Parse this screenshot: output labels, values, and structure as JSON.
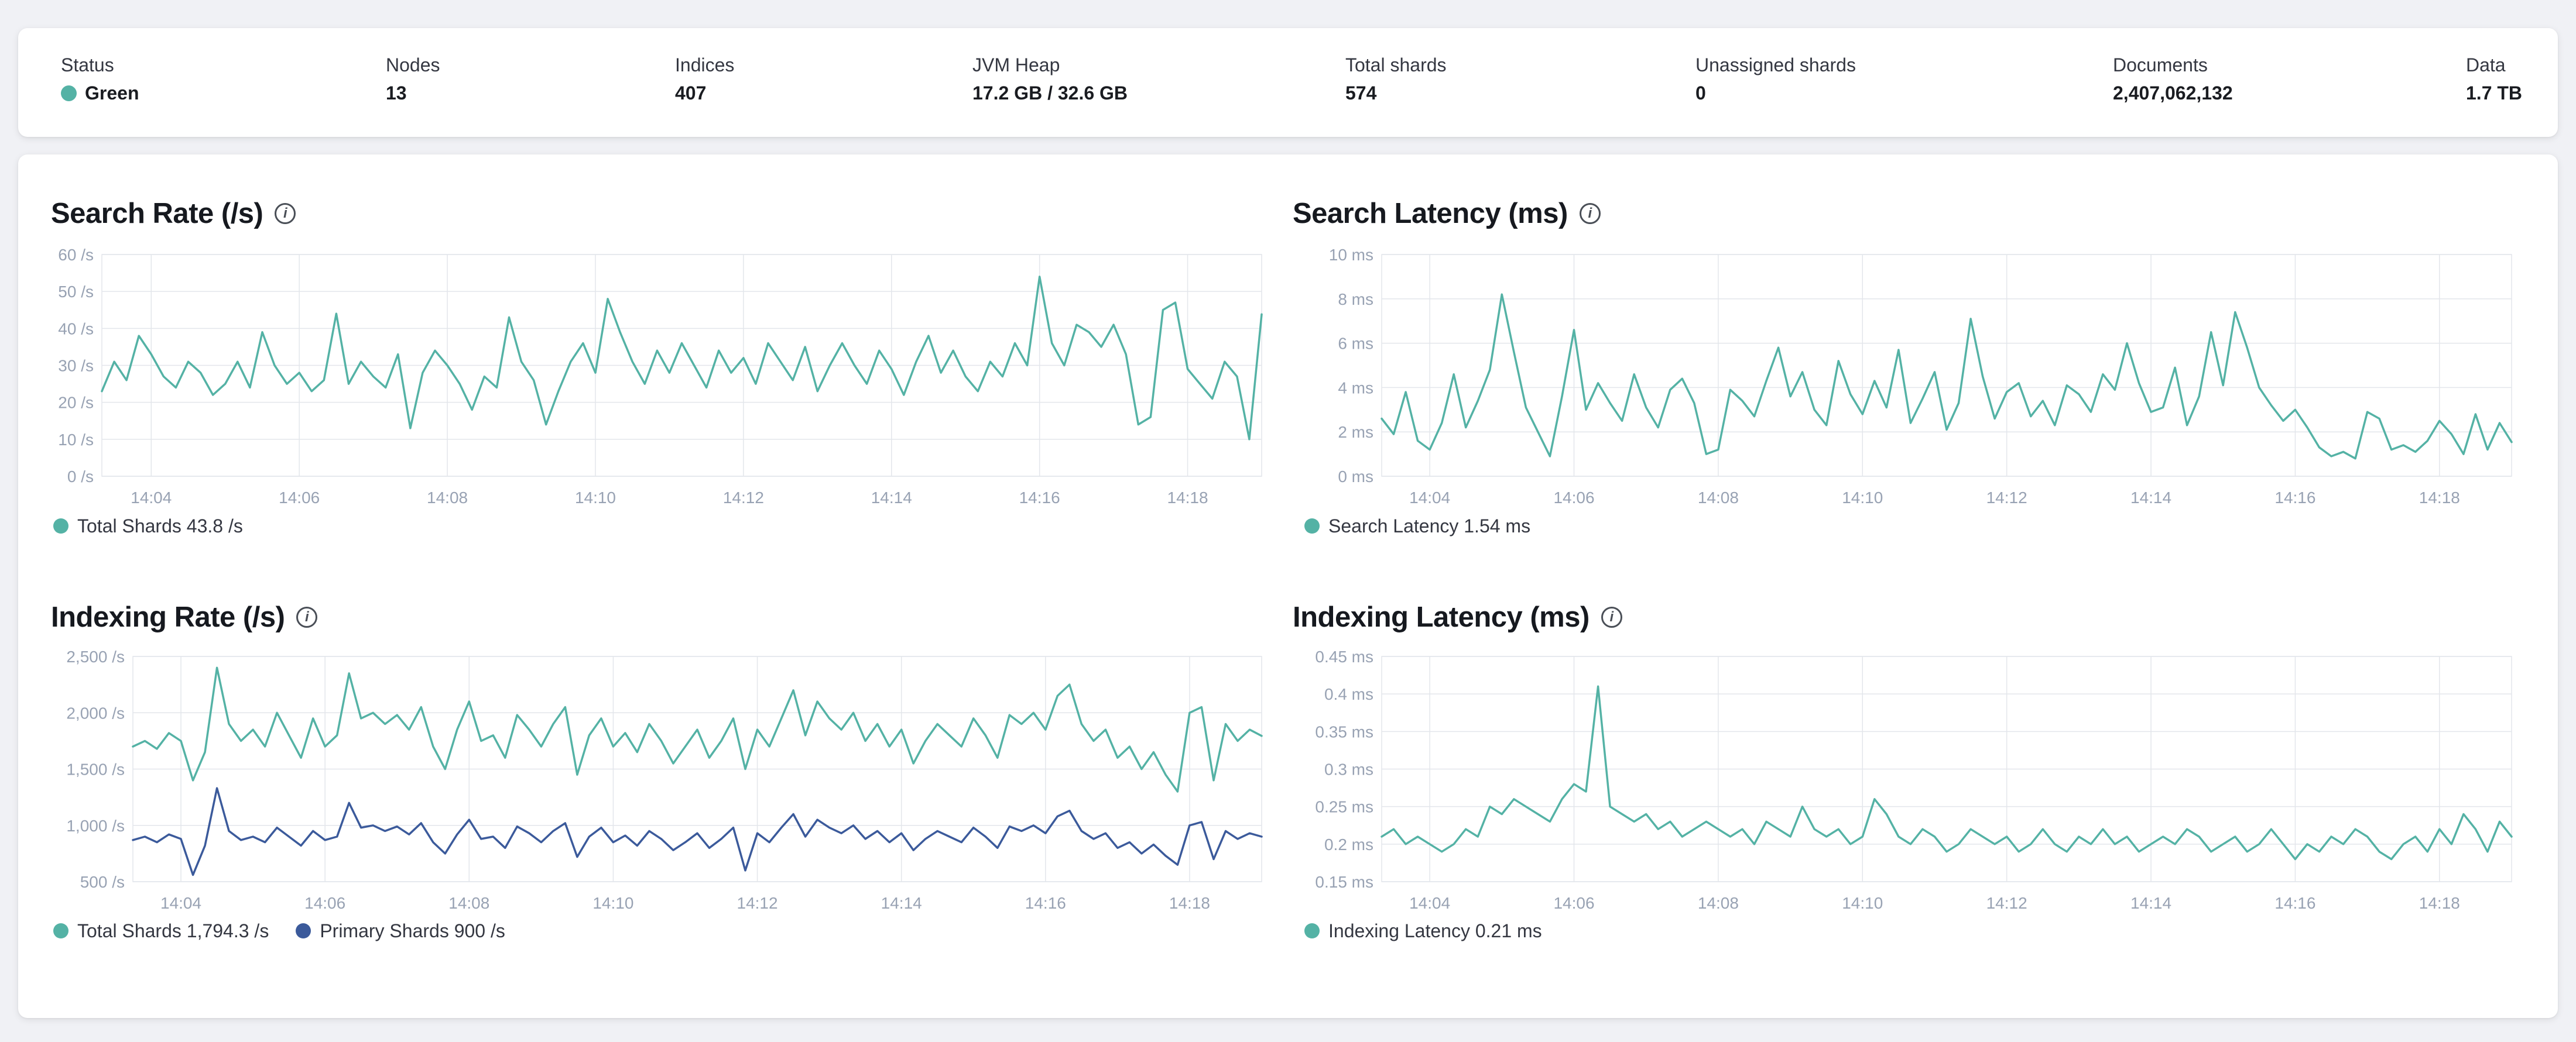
{
  "status_bar": {
    "status": {
      "label": "Status",
      "value": "Green",
      "dot_color": "#54b2a5"
    },
    "stats": [
      {
        "label": "Nodes",
        "value": "13"
      },
      {
        "label": "Indices",
        "value": "407"
      },
      {
        "label": "JVM Heap",
        "value": "17.2 GB / 32.6 GB"
      },
      {
        "label": "Total shards",
        "value": "574"
      },
      {
        "label": "Unassigned shards",
        "value": "0"
      },
      {
        "label": "Documents",
        "value": "2,407,062,132"
      },
      {
        "label": "Data",
        "value": "1.7 TB"
      }
    ]
  },
  "colors": {
    "teal": "#54b2a5",
    "navy": "#3b5a9b",
    "grid": "#e3e6eb",
    "axis_text": "#98a2b3"
  },
  "chart_data": [
    {
      "type": "line",
      "title": "Search Rate (/s)",
      "ylim": [
        0,
        60
      ],
      "y_ticks": [
        {
          "v": 0,
          "label": "0 /s"
        },
        {
          "v": 10,
          "label": "10 /s"
        },
        {
          "v": 20,
          "label": "20 /s"
        },
        {
          "v": 30,
          "label": "30 /s"
        },
        {
          "v": 40,
          "label": "40 /s"
        },
        {
          "v": 50,
          "label": "50 /s"
        },
        {
          "v": 60,
          "label": "60 /s"
        }
      ],
      "x_ticks": [
        {
          "i": 4,
          "label": "14:04"
        },
        {
          "i": 16,
          "label": "14:06"
        },
        {
          "i": 28,
          "label": "14:08"
        },
        {
          "i": 40,
          "label": "14:10"
        },
        {
          "i": 52,
          "label": "14:12"
        },
        {
          "i": 64,
          "label": "14:14"
        },
        {
          "i": 76,
          "label": "14:16"
        },
        {
          "i": 88,
          "label": "14:18"
        }
      ],
      "legend": [
        {
          "label": "Total Shards 43.8 /s",
          "color": "#54b2a5"
        }
      ],
      "series": [
        {
          "name": "total-shards",
          "color": "#54b2a5",
          "values": [
            23,
            31,
            26,
            38,
            33,
            27,
            24,
            31,
            28,
            22,
            25,
            31,
            24,
            39,
            30,
            25,
            28,
            23,
            26,
            44,
            25,
            31,
            27,
            24,
            33,
            13,
            28,
            34,
            30,
            25,
            18,
            27,
            24,
            43,
            31,
            26,
            14,
            23,
            31,
            36,
            28,
            48,
            39,
            31,
            25,
            34,
            28,
            36,
            30,
            24,
            34,
            28,
            32,
            25,
            36,
            31,
            26,
            35,
            23,
            30,
            36,
            30,
            25,
            34,
            29,
            22,
            31,
            38,
            28,
            34,
            27,
            23,
            31,
            27,
            36,
            30,
            54,
            36,
            30,
            41,
            39,
            35,
            41,
            33,
            14,
            16,
            45,
            47,
            29,
            25,
            21,
            31,
            27,
            10,
            43.8
          ]
        }
      ]
    },
    {
      "type": "line",
      "title": "Search Latency (ms)",
      "ylim": [
        0,
        10
      ],
      "y_ticks": [
        {
          "v": 0,
          "label": "0 ms"
        },
        {
          "v": 2,
          "label": "2 ms"
        },
        {
          "v": 4,
          "label": "4 ms"
        },
        {
          "v": 6,
          "label": "6 ms"
        },
        {
          "v": 8,
          "label": "8 ms"
        },
        {
          "v": 10,
          "label": "10 ms"
        }
      ],
      "x_ticks": [
        {
          "i": 4,
          "label": "14:04"
        },
        {
          "i": 16,
          "label": "14:06"
        },
        {
          "i": 28,
          "label": "14:08"
        },
        {
          "i": 40,
          "label": "14:10"
        },
        {
          "i": 52,
          "label": "14:12"
        },
        {
          "i": 64,
          "label": "14:14"
        },
        {
          "i": 76,
          "label": "14:16"
        },
        {
          "i": 88,
          "label": "14:18"
        }
      ],
      "legend": [
        {
          "label": "Search Latency 1.54 ms",
          "color": "#54b2a5"
        }
      ],
      "series": [
        {
          "name": "search-latency",
          "color": "#54b2a5",
          "values": [
            2.6,
            1.9,
            3.8,
            1.6,
            1.2,
            2.4,
            4.6,
            2.2,
            3.4,
            4.8,
            8.2,
            5.6,
            3.1,
            2.0,
            0.9,
            3.6,
            6.6,
            3.0,
            4.2,
            3.3,
            2.5,
            4.6,
            3.1,
            2.2,
            3.9,
            4.4,
            3.3,
            1.0,
            1.2,
            3.9,
            3.4,
            2.7,
            4.3,
            5.8,
            3.6,
            4.7,
            3.0,
            2.3,
            5.2,
            3.7,
            2.8,
            4.3,
            3.1,
            5.7,
            2.4,
            3.5,
            4.7,
            2.1,
            3.3,
            7.1,
            4.5,
            2.6,
            3.8,
            4.2,
            2.7,
            3.4,
            2.3,
            4.1,
            3.7,
            2.9,
            4.6,
            3.9,
            6.0,
            4.2,
            2.9,
            3.1,
            4.9,
            2.3,
            3.6,
            6.5,
            4.1,
            7.4,
            5.8,
            4.0,
            3.2,
            2.5,
            3.0,
            2.2,
            1.3,
            0.9,
            1.1,
            0.8,
            2.9,
            2.6,
            1.2,
            1.4,
            1.1,
            1.6,
            2.5,
            1.9,
            1.0,
            2.8,
            1.2,
            2.4,
            1.54
          ]
        }
      ]
    },
    {
      "type": "line",
      "title": "Indexing Rate (/s)",
      "ylim": [
        500,
        2500
      ],
      "y_ticks": [
        {
          "v": 500,
          "label": "500 /s"
        },
        {
          "v": 1000,
          "label": "1,000 /s"
        },
        {
          "v": 1500,
          "label": "1,500 /s"
        },
        {
          "v": 2000,
          "label": "2,000 /s"
        },
        {
          "v": 2500,
          "label": "2,500 /s"
        }
      ],
      "x_ticks": [
        {
          "i": 4,
          "label": "14:04"
        },
        {
          "i": 16,
          "label": "14:06"
        },
        {
          "i": 28,
          "label": "14:08"
        },
        {
          "i": 40,
          "label": "14:10"
        },
        {
          "i": 52,
          "label": "14:12"
        },
        {
          "i": 64,
          "label": "14:14"
        },
        {
          "i": 76,
          "label": "14:16"
        },
        {
          "i": 88,
          "label": "14:18"
        }
      ],
      "legend": [
        {
          "label": "Total Shards 1,794.3 /s",
          "color": "#54b2a5"
        },
        {
          "label": "Primary Shards 900 /s",
          "color": "#3b5a9b"
        }
      ],
      "series": [
        {
          "name": "total-shards",
          "color": "#54b2a5",
          "values": [
            1700,
            1750,
            1680,
            1820,
            1750,
            1400,
            1650,
            2400,
            1900,
            1750,
            1850,
            1700,
            2000,
            1800,
            1600,
            1950,
            1700,
            1800,
            2350,
            1950,
            2000,
            1900,
            1980,
            1850,
            2050,
            1700,
            1500,
            1850,
            2100,
            1750,
            1800,
            1600,
            1980,
            1850,
            1700,
            1900,
            2050,
            1450,
            1800,
            1950,
            1700,
            1820,
            1650,
            1900,
            1750,
            1550,
            1700,
            1850,
            1600,
            1750,
            1950,
            1500,
            1850,
            1700,
            1950,
            2200,
            1800,
            2100,
            1950,
            1850,
            2000,
            1750,
            1900,
            1700,
            1850,
            1550,
            1750,
            1900,
            1800,
            1700,
            1950,
            1800,
            1600,
            1980,
            1900,
            2000,
            1850,
            2150,
            2250,
            1900,
            1750,
            1850,
            1600,
            1700,
            1500,
            1650,
            1450,
            1300,
            2000,
            2050,
            1400,
            1900,
            1750,
            1850,
            1794.3
          ]
        },
        {
          "name": "primary-shards",
          "color": "#3b5a9b",
          "values": [
            870,
            900,
            850,
            920,
            880,
            560,
            820,
            1330,
            950,
            870,
            900,
            850,
            980,
            900,
            820,
            950,
            870,
            900,
            1200,
            980,
            1000,
            950,
            990,
            920,
            1020,
            850,
            750,
            920,
            1050,
            880,
            900,
            800,
            990,
            930,
            850,
            950,
            1020,
            720,
            900,
            980,
            850,
            910,
            820,
            950,
            880,
            780,
            850,
            930,
            800,
            880,
            980,
            600,
            930,
            850,
            980,
            1100,
            900,
            1050,
            980,
            930,
            1000,
            880,
            950,
            850,
            930,
            780,
            880,
            950,
            900,
            850,
            980,
            900,
            800,
            990,
            950,
            1000,
            930,
            1080,
            1130,
            950,
            880,
            930,
            800,
            850,
            750,
            830,
            730,
            650,
            1000,
            1030,
            700,
            950,
            880,
            930,
            900
          ]
        }
      ]
    },
    {
      "type": "line",
      "title": "Indexing Latency (ms)",
      "ylim": [
        0.15,
        0.45
      ],
      "y_ticks": [
        {
          "v": 0.15,
          "label": "0.15 ms"
        },
        {
          "v": 0.2,
          "label": "0.2 ms"
        },
        {
          "v": 0.25,
          "label": "0.25 ms"
        },
        {
          "v": 0.3,
          "label": "0.3 ms"
        },
        {
          "v": 0.35,
          "label": "0.35 ms"
        },
        {
          "v": 0.4,
          "label": "0.4 ms"
        },
        {
          "v": 0.45,
          "label": "0.45 ms"
        }
      ],
      "x_ticks": [
        {
          "i": 4,
          "label": "14:04"
        },
        {
          "i": 16,
          "label": "14:06"
        },
        {
          "i": 28,
          "label": "14:08"
        },
        {
          "i": 40,
          "label": "14:10"
        },
        {
          "i": 52,
          "label": "14:12"
        },
        {
          "i": 64,
          "label": "14:14"
        },
        {
          "i": 76,
          "label": "14:16"
        },
        {
          "i": 88,
          "label": "14:18"
        }
      ],
      "legend": [
        {
          "label": "Indexing Latency 0.21 ms",
          "color": "#54b2a5"
        }
      ],
      "series": [
        {
          "name": "indexing-latency",
          "color": "#54b2a5",
          "values": [
            0.21,
            0.22,
            0.2,
            0.21,
            0.2,
            0.19,
            0.2,
            0.22,
            0.21,
            0.25,
            0.24,
            0.26,
            0.25,
            0.24,
            0.23,
            0.26,
            0.28,
            0.27,
            0.41,
            0.25,
            0.24,
            0.23,
            0.24,
            0.22,
            0.23,
            0.21,
            0.22,
            0.23,
            0.22,
            0.21,
            0.22,
            0.2,
            0.23,
            0.22,
            0.21,
            0.25,
            0.22,
            0.21,
            0.22,
            0.2,
            0.21,
            0.26,
            0.24,
            0.21,
            0.2,
            0.22,
            0.21,
            0.19,
            0.2,
            0.22,
            0.21,
            0.2,
            0.21,
            0.19,
            0.2,
            0.22,
            0.2,
            0.19,
            0.21,
            0.2,
            0.22,
            0.2,
            0.21,
            0.19,
            0.2,
            0.21,
            0.2,
            0.22,
            0.21,
            0.19,
            0.2,
            0.21,
            0.19,
            0.2,
            0.22,
            0.2,
            0.18,
            0.2,
            0.19,
            0.21,
            0.2,
            0.22,
            0.21,
            0.19,
            0.18,
            0.2,
            0.21,
            0.19,
            0.22,
            0.2,
            0.24,
            0.22,
            0.19,
            0.23,
            0.21
          ]
        }
      ]
    }
  ]
}
